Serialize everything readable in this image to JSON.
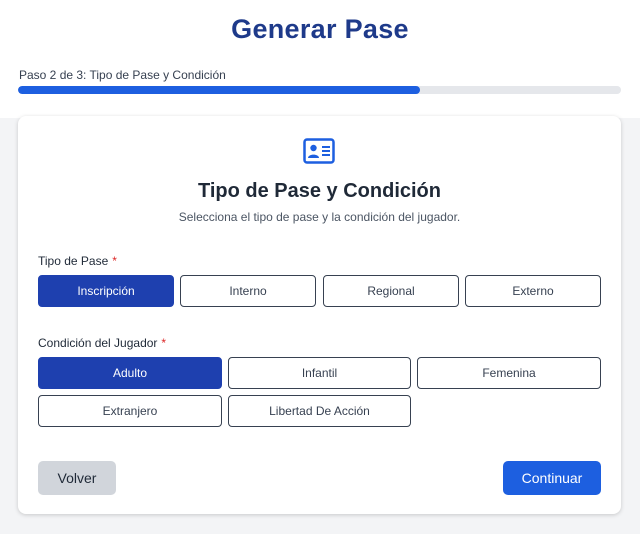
{
  "header": {
    "title": "Generar Pase",
    "step_text": "Paso 2 de 3: Tipo de Pase y Condición",
    "progress": 0.667
  },
  "card": {
    "icon": "id-card-icon",
    "title": "Tipo de Pase y Condición",
    "subtitle": "Selecciona el tipo de pase y la condición del jugador."
  },
  "tipo_pase": {
    "label": "Tipo de Pase",
    "required_mark": "*",
    "options": [
      "Inscripción",
      "Interno",
      "Regional",
      "Externo"
    ],
    "selected": "Inscripción"
  },
  "condicion": {
    "label": "Condición del Jugador",
    "required_mark": "*",
    "options": [
      "Adulto",
      "Infantil",
      "Femenina",
      "Extranjero",
      "Libertad De Acción"
    ],
    "selected": "Adulto"
  },
  "actions": {
    "back_label": "Volver",
    "next_label": "Continuar"
  },
  "colors": {
    "title": "#1e3a8a",
    "accent": "#1d5fe0",
    "selected": "#1e40af",
    "required": "#dc2626"
  }
}
